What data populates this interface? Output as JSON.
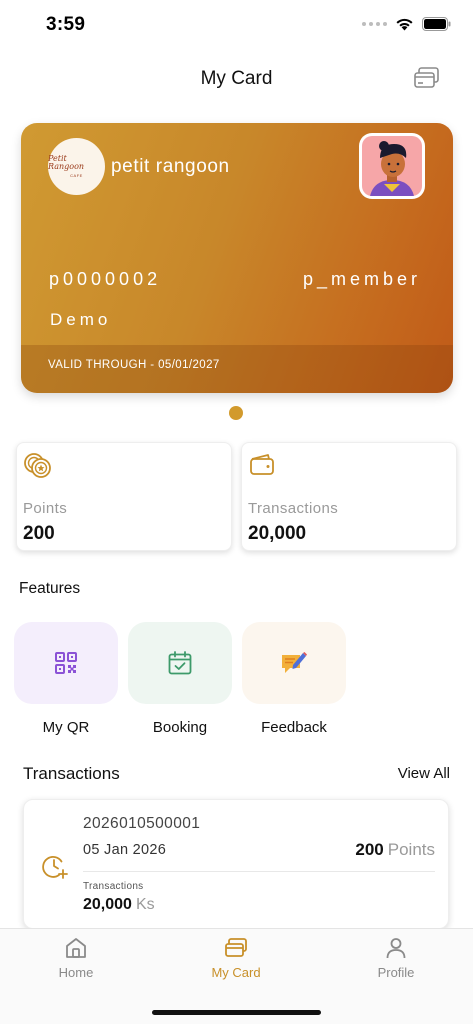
{
  "status_bar": {
    "time": "3:59"
  },
  "header": {
    "title": "My Card"
  },
  "card": {
    "logo_text": "Petit Rangoon",
    "logo_subtext": "CAFE",
    "brand": "petit rangoon",
    "member_id": "p0000002",
    "tier": "p_member",
    "name": "Demo",
    "valid_through": "VALID THROUGH - 05/01/2027",
    "gradient_colors": [
      "#d09a32",
      "#c05a18"
    ]
  },
  "stats": {
    "points_label": "Points",
    "points_value": "200",
    "transactions_label": "Transactions",
    "transactions_value": "20,000"
  },
  "features": {
    "title": "Features",
    "items": [
      {
        "label": "My QR",
        "icon": "qr-code-icon"
      },
      {
        "label": "Booking",
        "icon": "calendar-check-icon"
      },
      {
        "label": "Feedback",
        "icon": "feedback-icon"
      }
    ]
  },
  "transactions": {
    "title": "Transactions",
    "view_all": "View All",
    "items": [
      {
        "id": "2026010500001",
        "date": "05 Jan 2026",
        "points": "200",
        "points_unit": "Points",
        "sub_label": "Transactions",
        "amount": "20,000",
        "currency": "Ks"
      }
    ]
  },
  "tab_bar": {
    "items": [
      {
        "label": "Home",
        "icon": "home-icon"
      },
      {
        "label": "My Card",
        "icon": "card-icon",
        "active": true
      },
      {
        "label": "Profile",
        "icon": "person-icon"
      }
    ]
  },
  "colors": {
    "accent": "#c8902a",
    "primary_text": "#111111",
    "muted_text": "#9a9a9a"
  }
}
